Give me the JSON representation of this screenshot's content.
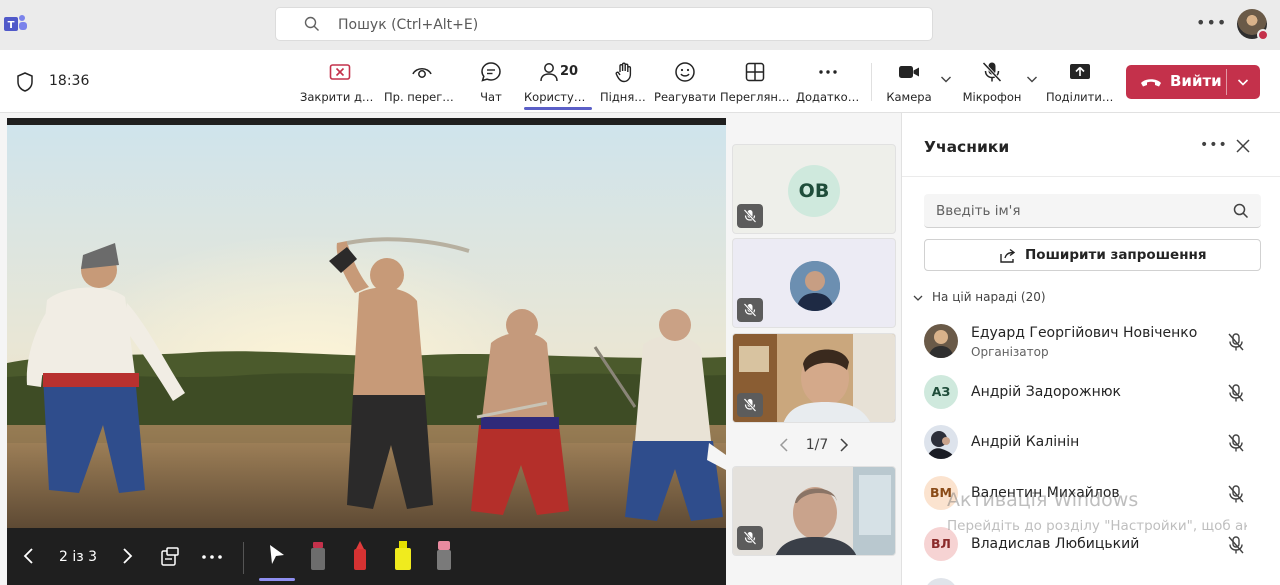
{
  "search": {
    "placeholder": "Пошук (Ctrl+Alt+E)"
  },
  "meeting": {
    "time": "18:36"
  },
  "toolbar": {
    "close_label": "Закрити дос…",
    "preview_label": "Пр. перегляд",
    "chat_label": "Чат",
    "users_label": "Користувачі",
    "users_count": "20",
    "raise_label": "Підняти",
    "react_label": "Реагувати",
    "view_label": "Переглянути",
    "more_label": "Додатково",
    "camera_label": "Камера",
    "mic_label": "Мікрофон",
    "share_label": "Поділитися",
    "leave_label": "Вийти"
  },
  "stage": {
    "page_counter": "2 із 3"
  },
  "tiles": {
    "first_initials": "OB",
    "pager": "1/7"
  },
  "panel": {
    "title": "Учасники",
    "search_placeholder": "Введіть ім'я",
    "share_invite_label": "Поширити запрошення",
    "section_label": "На цій нараді (20)",
    "participants": [
      {
        "name": "Едуард Георгійович Новіченко",
        "role": "Організатор",
        "initials": ""
      },
      {
        "name": "Андрій Задорожнюк",
        "role": "",
        "initials": "АЗ"
      },
      {
        "name": "Андрій Калінін",
        "role": "",
        "initials": ""
      },
      {
        "name": "Валентин Михайлов",
        "role": "",
        "initials": "ВМ"
      },
      {
        "name": "Владислав Любицький",
        "role": "",
        "initials": "ВЛ"
      }
    ]
  },
  "watermark": {
    "title": "Активація Windows",
    "subtitle": "Перейдіть до розділу \"Настройки\", щоб активувати Windows."
  },
  "colors": {
    "accent": "#5b5fc7",
    "leave": "#c4314b"
  }
}
